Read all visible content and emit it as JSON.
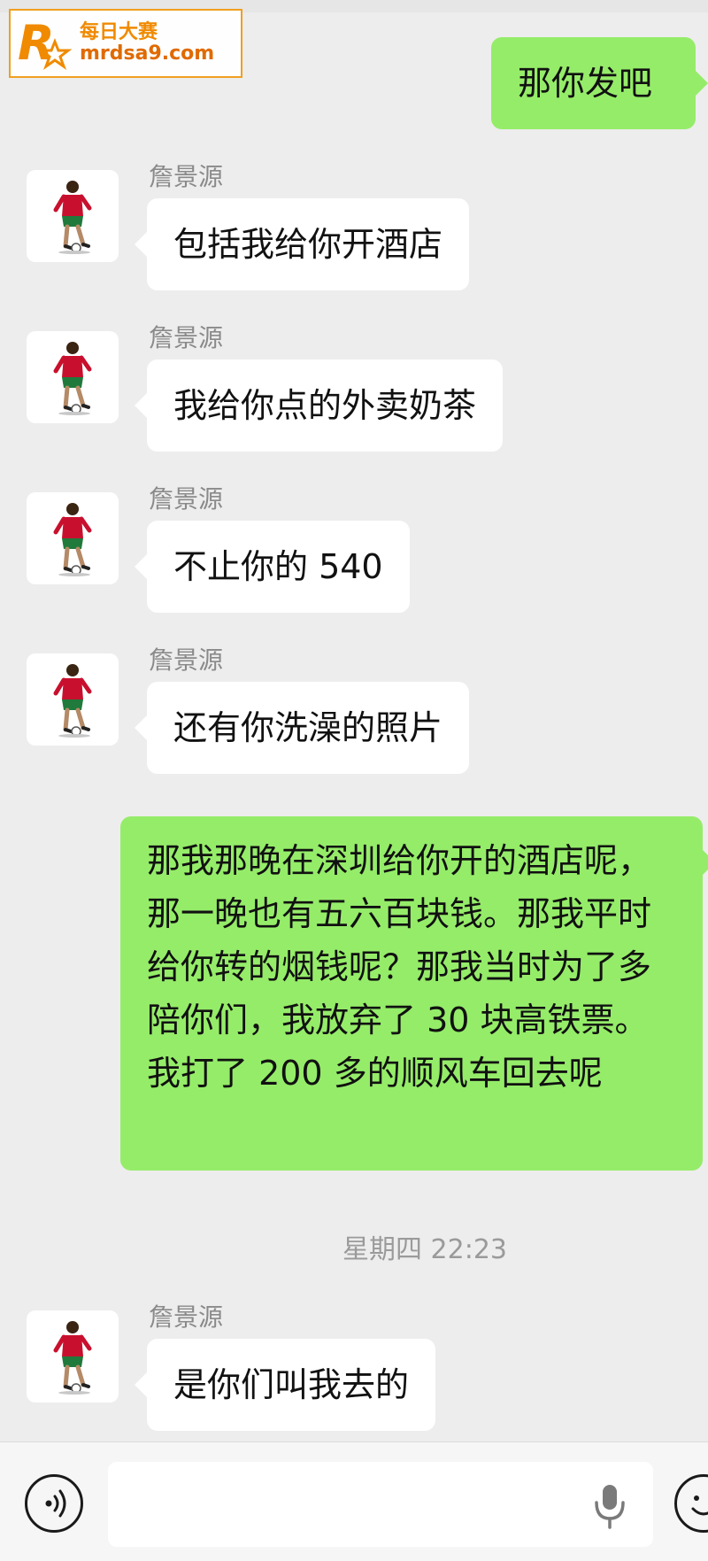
{
  "watermark": {
    "logo_letter": "R",
    "title": "每日大赛",
    "url": "mrdsa9.com",
    "accent_color": "#f08a00"
  },
  "colors": {
    "background": "#ededed",
    "incoming_bubble": "#ffffff",
    "outgoing_bubble": "#95ec69",
    "sender_name": "#8a8a8a"
  },
  "conversation": {
    "messages": [
      {
        "direction": "out",
        "text": "那你发吧"
      },
      {
        "direction": "in",
        "sender": "詹景源",
        "avatar_icon": "soccer-player-icon",
        "text": "包括我给你开酒店"
      },
      {
        "direction": "in",
        "sender": "詹景源",
        "avatar_icon": "soccer-player-icon",
        "text": "我给你点的外卖奶茶"
      },
      {
        "direction": "in",
        "sender": "詹景源",
        "avatar_icon": "soccer-player-icon",
        "text": "不止你的 540"
      },
      {
        "direction": "in",
        "sender": "詹景源",
        "avatar_icon": "soccer-player-icon",
        "text": "还有你洗澡的照片"
      },
      {
        "direction": "out",
        "text": "那我那晚在深圳给你开的酒店呢，那一晚也有五六百块钱。那我平时给你转的烟钱呢？那我当时为了多陪你们，我放弃了 30 块高铁票。我打了 200 多的顺风车回去呢"
      },
      {
        "direction": "in",
        "sender": "詹景源",
        "avatar_icon": "soccer-player-icon",
        "text": "是你们叫我去的"
      }
    ],
    "timestamp": "星期四 22:23"
  },
  "input_bar": {
    "voice_icon": "voice-toggle-icon",
    "mic_icon": "microphone-icon",
    "emoji_icon": "emoji-icon",
    "text_value": ""
  }
}
